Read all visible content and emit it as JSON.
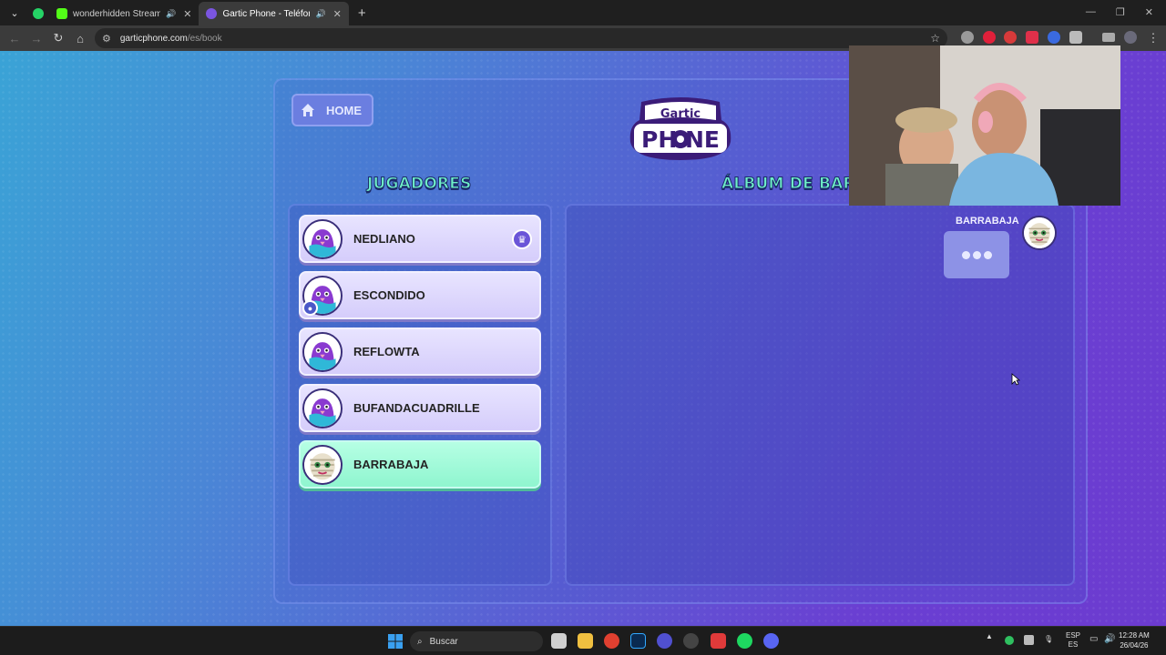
{
  "browser": {
    "tabs": [
      {
        "title": "wonderhidden Stream - W",
        "active": false
      },
      {
        "title": "Gartic Phone - Teléfono De",
        "active": true
      }
    ],
    "url_host": "garticphone.com",
    "url_path": "/es/book"
  },
  "game": {
    "home_label": "HOME",
    "players_title": "JUGADORES",
    "album_title": "ÁLBUM DE BAR",
    "players": [
      {
        "name": "NEDLIANO",
        "host": true
      },
      {
        "name": "ESCONDIDO",
        "badge": "user"
      },
      {
        "name": "REFLOWTA"
      },
      {
        "name": "BUFANDACUADRILLE"
      },
      {
        "name": "BARRABAJA",
        "current": true
      }
    ],
    "album_author": "BARRABAJA"
  },
  "taskbar": {
    "search_placeholder": "Buscar",
    "lang_top": "ESP",
    "lang_bottom": "ES",
    "time": "12:28 AM",
    "date": "26/04/26"
  },
  "colors": {
    "accent_green": "#6ff0c8",
    "player_bg": "#d5cdfb",
    "current_player_bg": "#8ff5cf"
  }
}
